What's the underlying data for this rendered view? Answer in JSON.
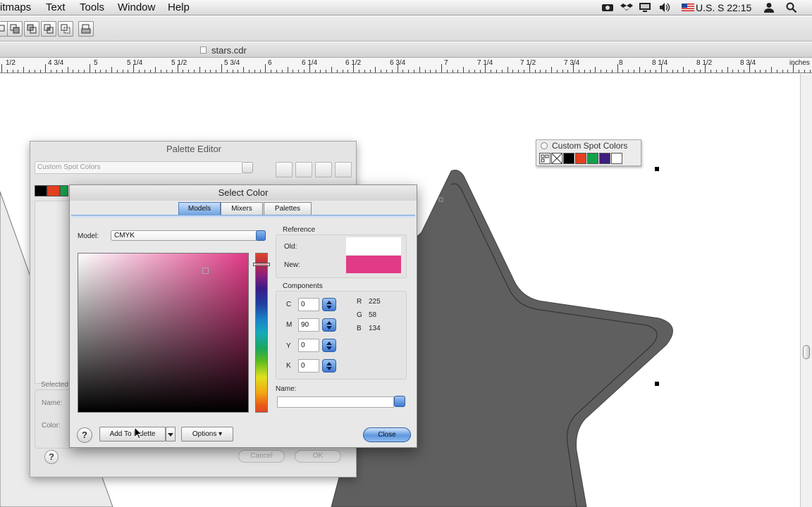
{
  "menubar": {
    "items": [
      "itmaps",
      "Text",
      "Tools",
      "Window",
      "Help"
    ],
    "input_source": "U.S.",
    "clock": "S 22:15"
  },
  "document": {
    "title": "stars.cdr",
    "ruler_labels": [
      "1/2",
      "4 3/4",
      "5",
      "5 1/4",
      "5 1/2",
      "5 3/4",
      "6",
      "6 1/4",
      "6 1/2",
      "6 3/4",
      "7",
      "7 1/4",
      "7 1/2",
      "7 3/4",
      "8",
      "8 1/4",
      "8 1/2",
      "8 3/4",
      "inches"
    ]
  },
  "spot_palette": {
    "title": "Custom Spot Colors",
    "swatches": [
      "#000000",
      "#e2401f",
      "#12a14a",
      "#3d1f7d",
      "#ffffff"
    ]
  },
  "palette_editor": {
    "title": "Palette Editor",
    "palette_name_placeholder": "Custom Spot Colors",
    "swatches": [
      "#000000",
      "#e2401f",
      "#12a14a"
    ],
    "selected_label": "Selected",
    "name_label": "Name:",
    "color_label": "Color:",
    "help_label": "?",
    "cancel_label": "Cancel",
    "ok_label": "OK"
  },
  "select_color": {
    "title": "Select Color",
    "tabs": [
      {
        "label": "Models",
        "active": true
      },
      {
        "label": "Mixers",
        "active": false
      },
      {
        "label": "Palettes",
        "active": false
      }
    ],
    "model_label": "Model:",
    "model_value": "CMYK",
    "reference_label": "Reference",
    "old_label": "Old:",
    "new_label": "New:",
    "old_color": "#ffffff",
    "new_color": "#e13a86",
    "components_label": "Components",
    "cmyk": [
      {
        "label": "C",
        "value": "0"
      },
      {
        "label": "M",
        "value": "90"
      },
      {
        "label": "Y",
        "value": "0"
      },
      {
        "label": "K",
        "value": "0"
      }
    ],
    "rgb": [
      {
        "label": "R",
        "value": "225"
      },
      {
        "label": "G",
        "value": "58"
      },
      {
        "label": "B",
        "value": "134"
      }
    ],
    "name_label": "Name:",
    "name_value": "",
    "help_label": "?",
    "add_to_palette_label": "Add To Palette",
    "options_label": "Options",
    "close_label": "Close"
  },
  "colors": {
    "star_fill": "#5f5f5f",
    "accent_blue": "#3f7ad2"
  }
}
